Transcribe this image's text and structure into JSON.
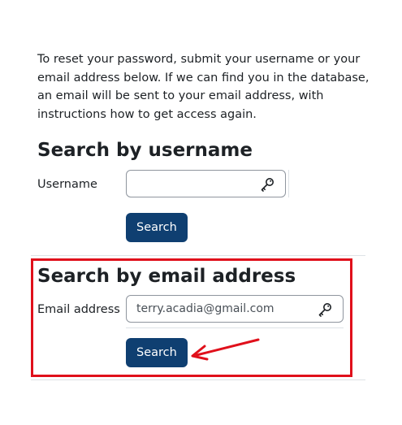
{
  "intro": {
    "text": "To reset your password, submit your username or your email address below. If we can find you in the database, an email will be sent to your email address, with instructions how to get access again."
  },
  "username_section": {
    "heading": "Search by username",
    "label": "Username",
    "value": "",
    "button_label": "Search",
    "icon": "key-icon"
  },
  "email_section": {
    "heading": "Search by email address",
    "label": "Email address",
    "value": "terry.acadia@gmail.com",
    "button_label": "Search",
    "icon": "key-icon"
  },
  "annotation": {
    "highlight_color": "#e0101b",
    "button_color": "#0f3f71"
  }
}
